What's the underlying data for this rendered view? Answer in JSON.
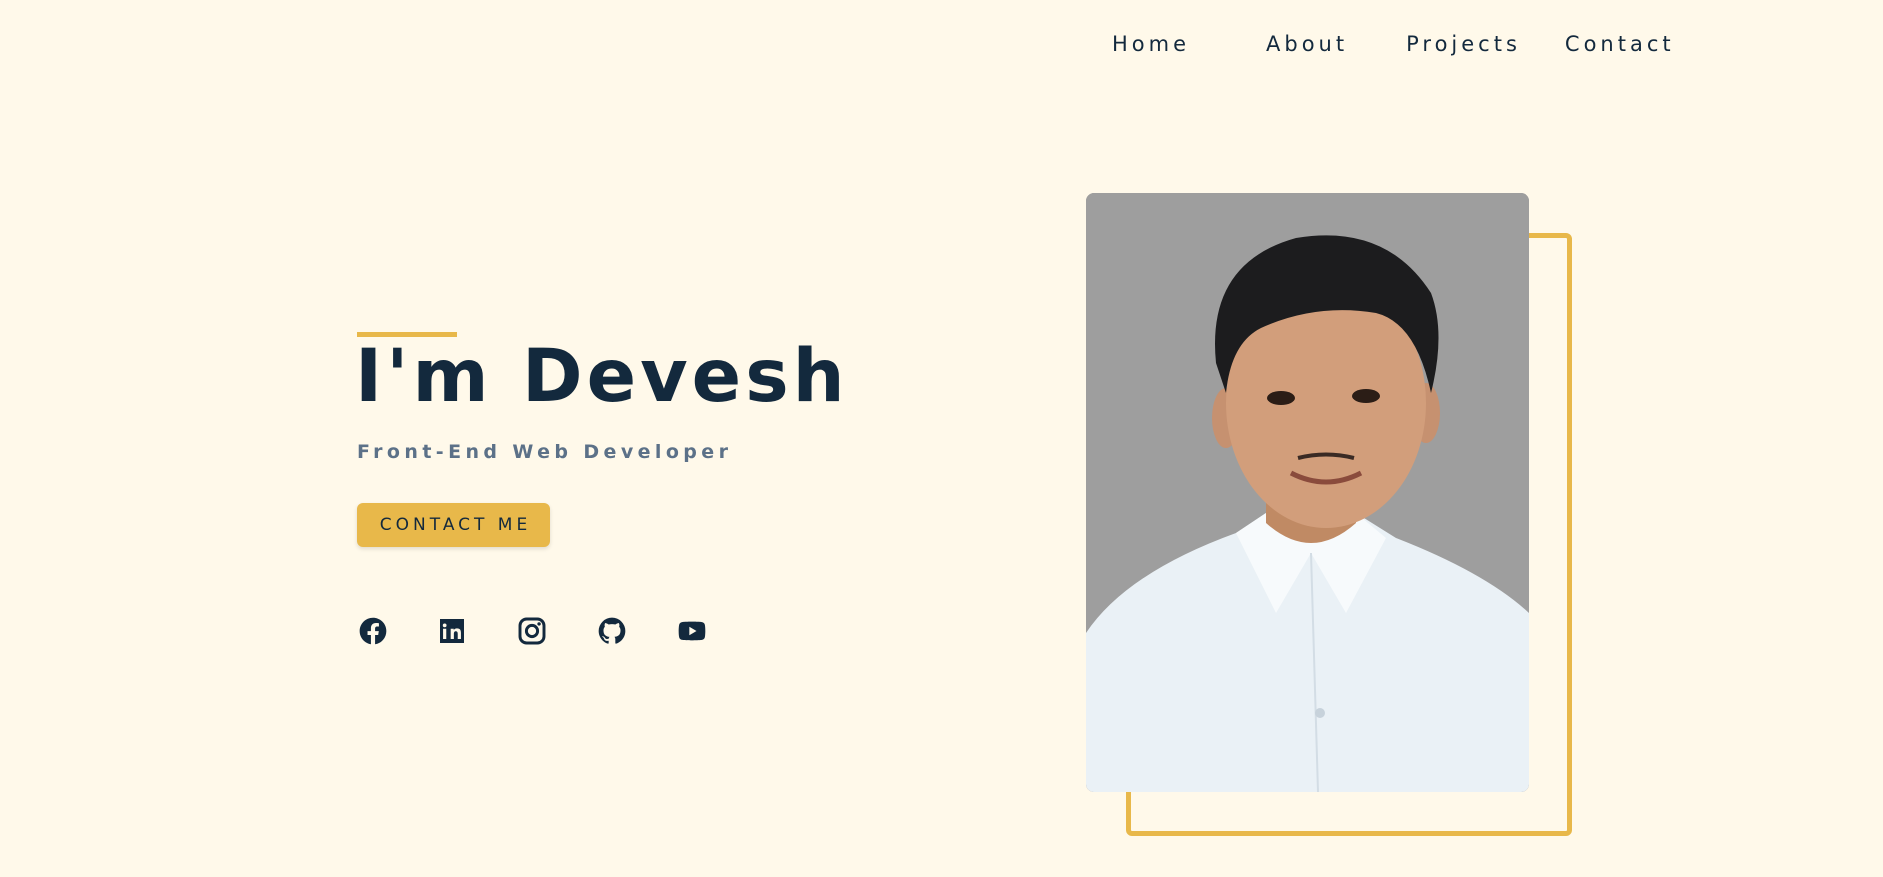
{
  "nav": {
    "items": [
      "Home",
      "About",
      "Projects",
      "Contact"
    ]
  },
  "hero": {
    "title": "I'm Devesh",
    "subtitle": "Front-End Web Developer",
    "cta_label": "CONTACT ME"
  },
  "social": {
    "icons": [
      "facebook-icon",
      "linkedin-icon",
      "instagram-icon",
      "github-icon",
      "youtube-icon"
    ]
  },
  "portrait": {
    "alt": "Portrait of Devesh"
  },
  "colors": {
    "background": "#fff9ea",
    "accent": "#e8b84a",
    "text_dark": "#13293d",
    "text_muted": "#5c7188",
    "photo_background": "#9e9e9e"
  }
}
